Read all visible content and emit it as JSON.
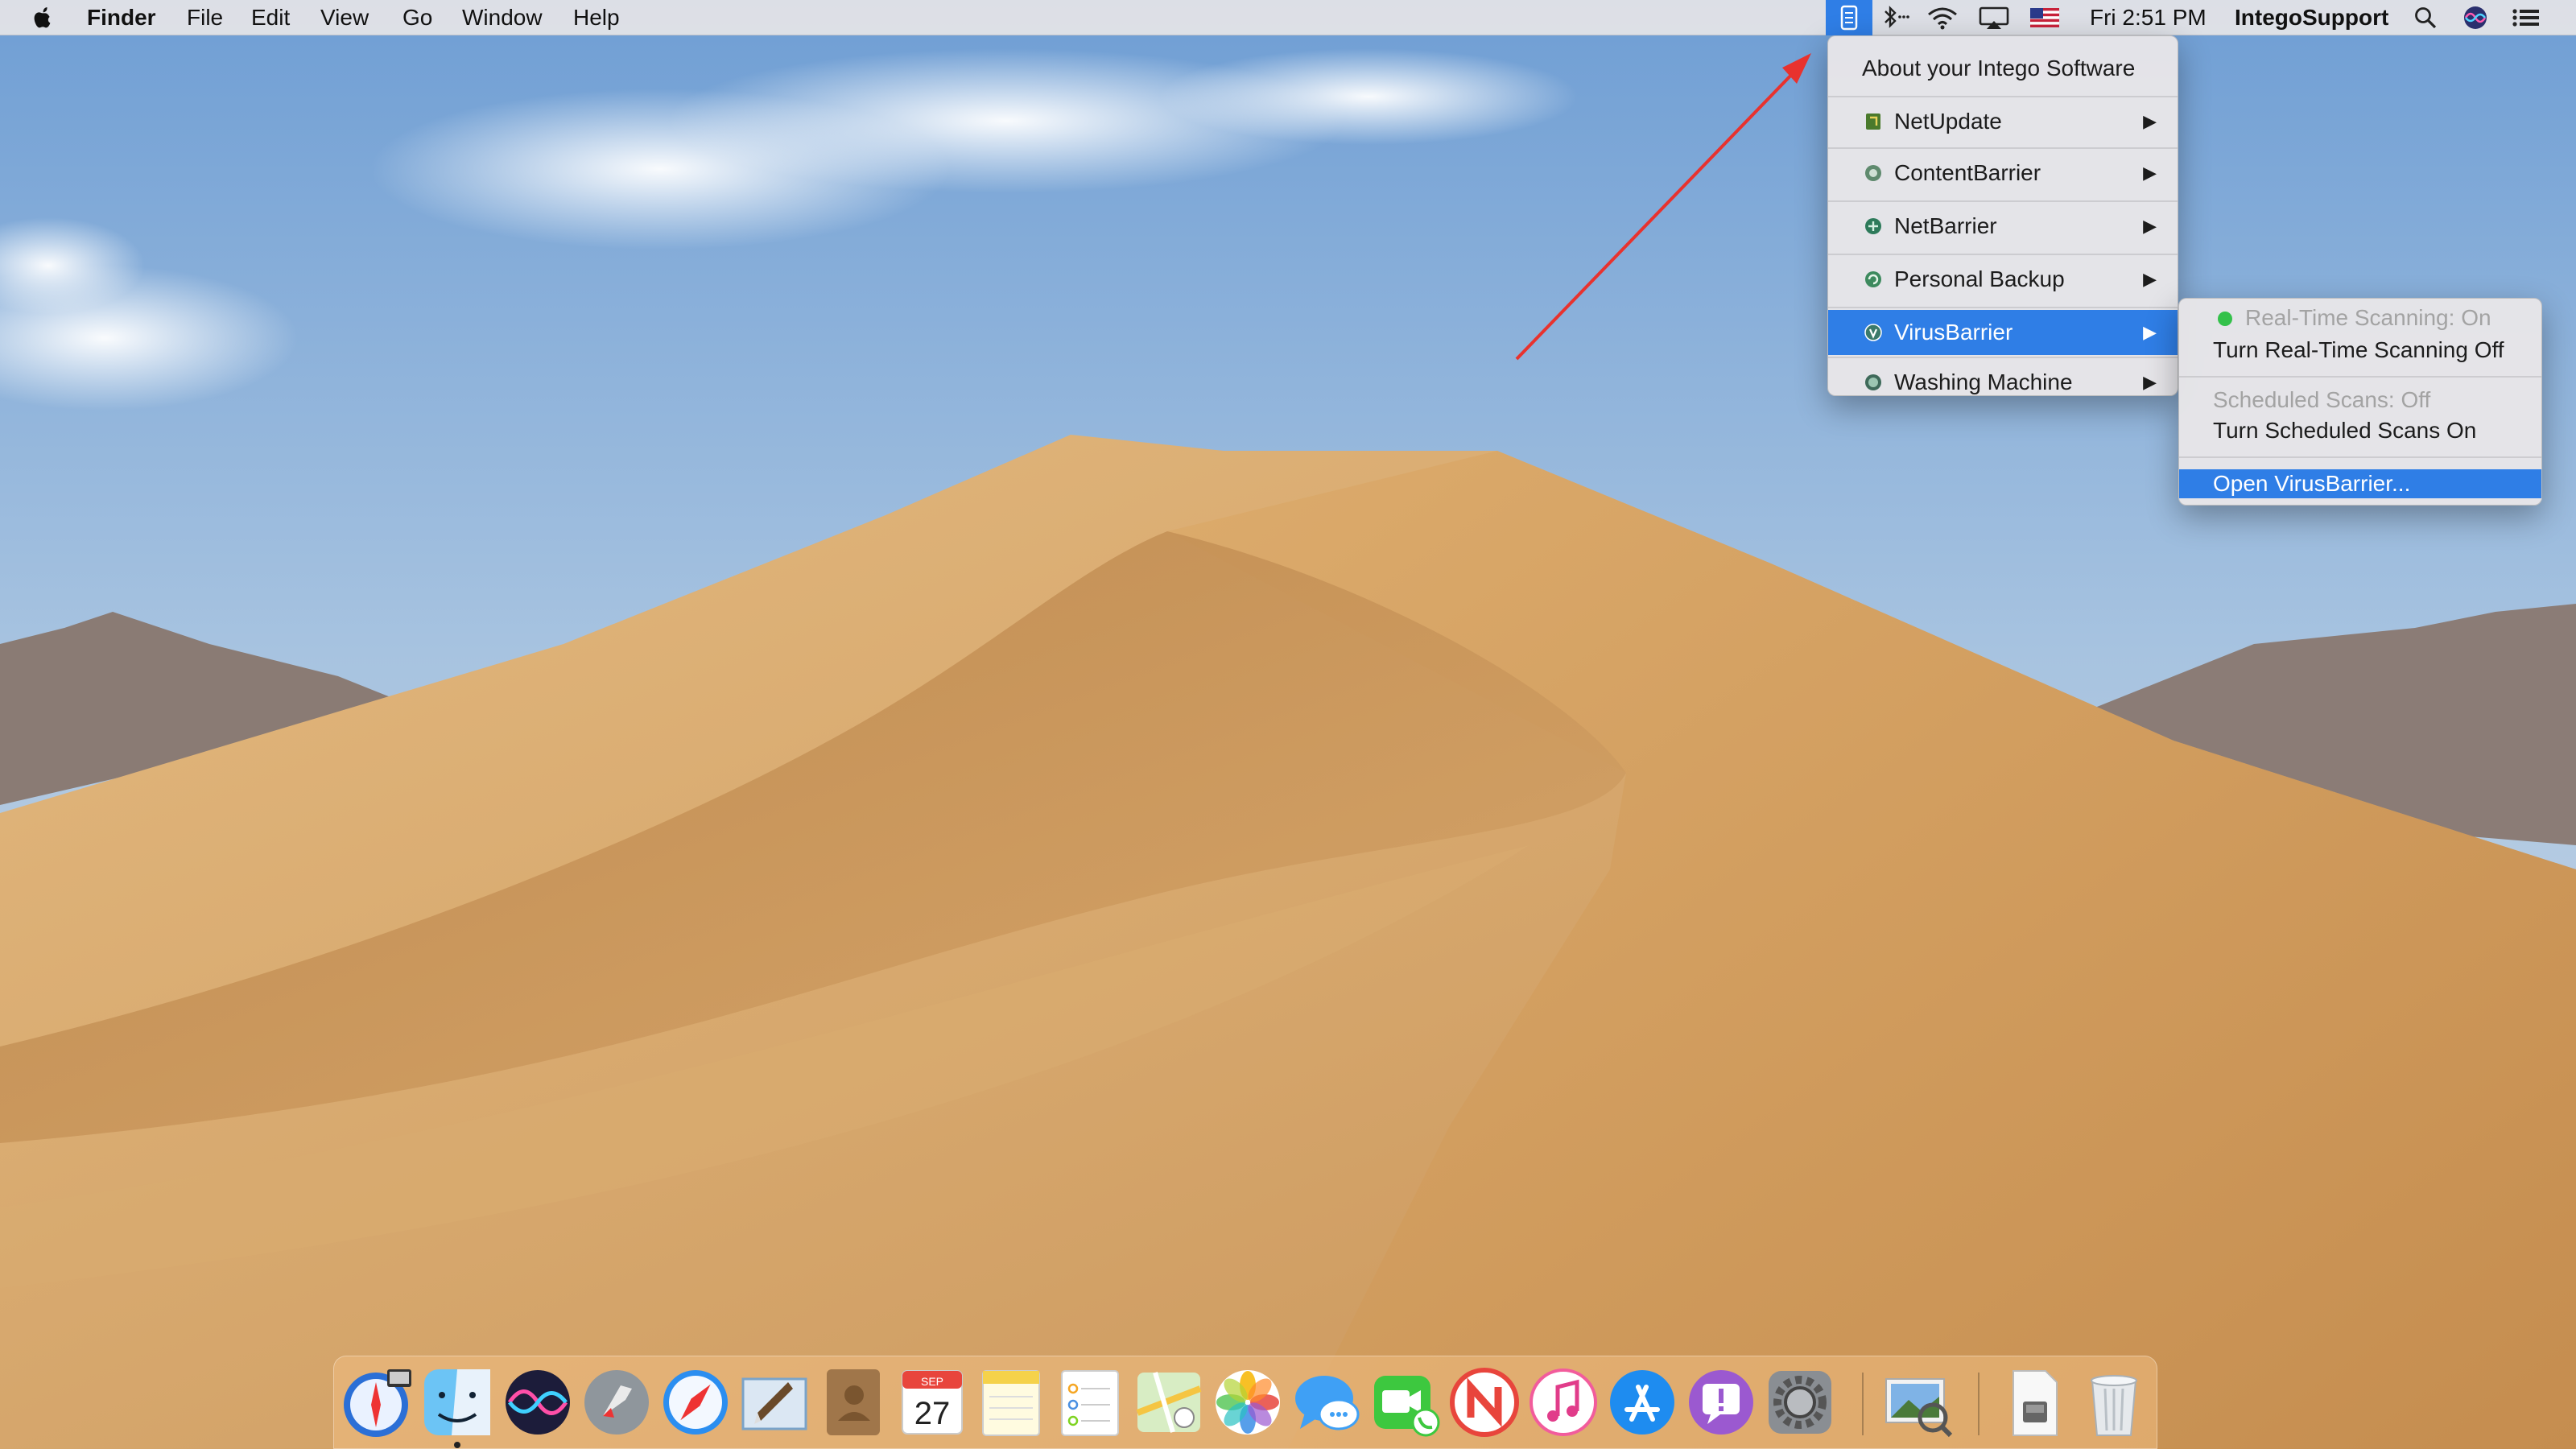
{
  "menubar": {
    "app_name": "Finder",
    "menus": [
      "File",
      "Edit",
      "View",
      "Go",
      "Window",
      "Help"
    ],
    "clock": "Fri 2:51 PM",
    "user": "IntegoSupport",
    "status_icons": [
      "intego-icon",
      "bluetooth-icon",
      "wifi-icon",
      "airplay-icon",
      "us-flag-icon",
      "spotlight-icon",
      "siri-icon",
      "notification-center-icon"
    ]
  },
  "intego_menu": {
    "about": "About your Intego Software",
    "items": [
      {
        "label": "NetUpdate",
        "icon_color": "#4a7a2c"
      },
      {
        "label": "ContentBarrier",
        "icon_color": "#5f8a6e"
      },
      {
        "label": "NetBarrier",
        "icon_color": "#2d7a5a"
      },
      {
        "label": "Personal Backup",
        "icon_color": "#3d8a5e"
      },
      {
        "label": "VirusBarrier",
        "icon_color": "#3c7a6a"
      },
      {
        "label": "Washing Machine",
        "icon_color": "#3f6a5a"
      }
    ],
    "arrow": "▶"
  },
  "virusbarrier_submenu": {
    "realtime_status": "Real-Time Scanning: On",
    "realtime_toggle": "Turn Real-Time Scanning Off",
    "scheduled_status": "Scheduled Scans: Off",
    "scheduled_toggle": "Turn Scheduled Scans On",
    "open": "Open VirusBarrier...",
    "status_dot_color": "#33c14a"
  },
  "dock": {
    "calendar_month": "SEP",
    "calendar_day": "27",
    "apps": [
      "Screen Sharing",
      "Finder",
      "Siri",
      "Launchpad",
      "Safari",
      "Mail",
      "Contacts",
      "Calendar",
      "Notes",
      "Reminders",
      "Maps",
      "Photos",
      "Messages",
      "FaceTime",
      "News",
      "iTunes",
      "App Store",
      "Feedback Assistant",
      "System Preferences",
      "Preview",
      "Documents",
      "Trash"
    ]
  },
  "colors": {
    "highlight": "#2f7ee6",
    "annotation_arrow": "#e8322e"
  }
}
